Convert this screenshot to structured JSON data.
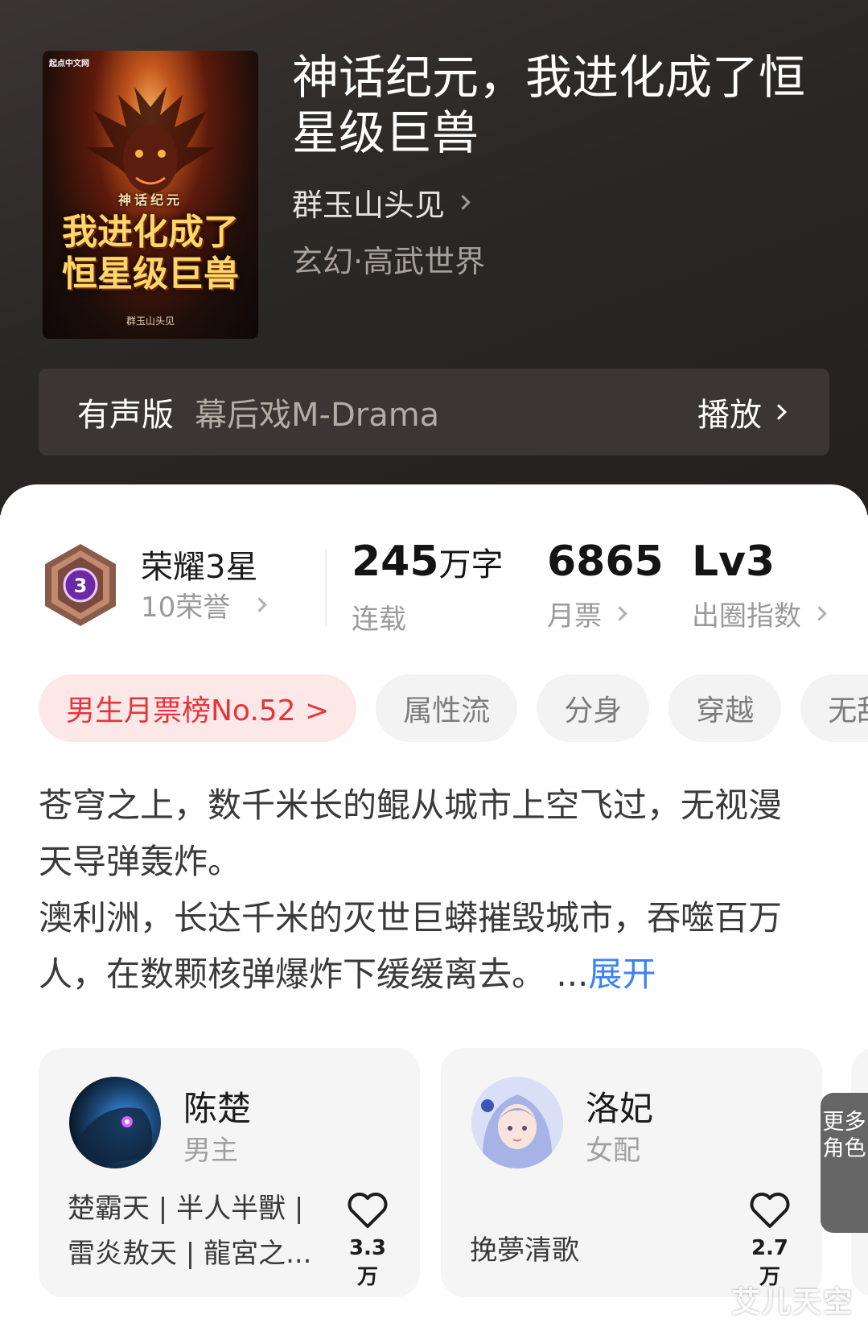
{
  "book": {
    "title": "神话纪元，我进化成了恒星级巨兽",
    "author": "群玉山头见",
    "genre": "玄幻·高武世界",
    "cover": {
      "publisher": "起点中文网",
      "series": "神话纪元",
      "title_line1": "我进化成了",
      "title_line2": "恒星级巨兽",
      "author": "群玉山头见"
    }
  },
  "audio": {
    "label": "有声版",
    "source": "幕后戏M-Drama",
    "play": "播放"
  },
  "honor": {
    "level_number": "3",
    "title": "荣耀3星",
    "subtitle": "10荣誉"
  },
  "stats": {
    "words_value": "245",
    "words_unit": "万字",
    "words_label": "连载",
    "tickets_value": "6865",
    "tickets_label": "月票",
    "index_value": "Lv3",
    "index_label": "出圈指数"
  },
  "tags": [
    "男生月票榜No.52 >",
    "属性流",
    "分身",
    "穿越",
    "无敌"
  ],
  "description": {
    "text": "苍穹之上，数千米长的鲲从城市上空飞过，无视漫天导弹轰炸。\n澳利洲，长达千米的灭世巨蟒摧毁城市，吞噬百万人，在数颗核弹爆炸下缓缓离去。 ...",
    "expand": "展开"
  },
  "characters": [
    {
      "name": "陈楚",
      "role": "男主",
      "aliases": "楚霸天 | 半人半獸 | 雷炎敖天 | 龍宮之...",
      "likes": "3.3万"
    },
    {
      "name": "洛妃",
      "role": "女配",
      "aliases": "挽夢清歌",
      "likes": "2.7万"
    }
  ],
  "more_roles": "更多角色",
  "watermark": "艾儿天空",
  "colors": {
    "accent_red": "#e5353b",
    "link_blue": "#3b82f6",
    "header_dark": "#2b2724",
    "medal_purple": "#6a2aa5"
  },
  "icons": {
    "author_arrow": "chevron-right-icon",
    "play_arrow": "chevron-right-icon",
    "like": "heart-icon",
    "honor": "medal-icon"
  }
}
